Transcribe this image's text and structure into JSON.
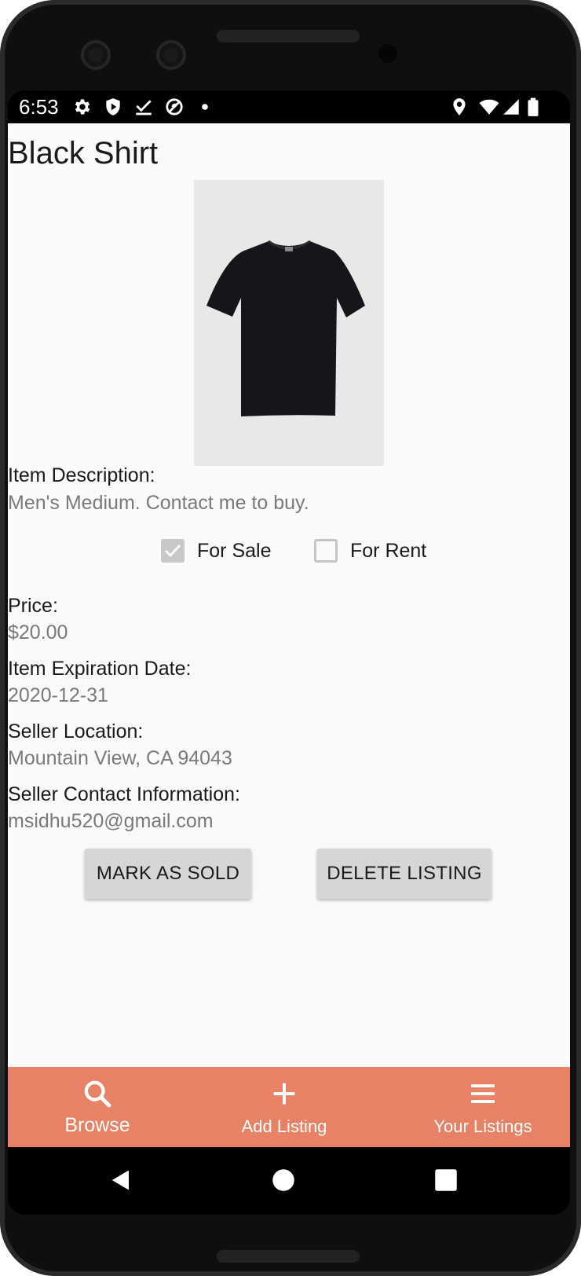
{
  "status_bar": {
    "time": "6:53",
    "left_icons": [
      "gear-icon",
      "shield-icon",
      "task-check-icon",
      "data-saver-icon",
      "dot-icon"
    ],
    "right_icons": [
      "location-icon",
      "wifi-icon",
      "signal-icon",
      "battery-icon"
    ]
  },
  "listing": {
    "title": "Black Shirt",
    "image_subject": "black t-shirt",
    "description_label": "Item Description:",
    "description_value": "Men's Medium. Contact me to buy.",
    "for_sale_label": "For Sale",
    "for_sale_checked": true,
    "for_rent_label": "For Rent",
    "for_rent_checked": false,
    "price_label": "Price:",
    "price_value": "$20.00",
    "expiration_label": "Item Expiration Date:",
    "expiration_value": "2020-12-31",
    "location_label": "Seller Location:",
    "location_value": "Mountain View, CA 94043",
    "contact_label": "Seller Contact Information:",
    "contact_value": "msidhu520@gmail.com"
  },
  "actions": {
    "mark_sold": "MARK AS SOLD",
    "delete": "DELETE LISTING"
  },
  "bottom_nav": {
    "accent_color": "#e78267",
    "items": [
      {
        "label": "Browse",
        "icon": "search-icon",
        "active": true
      },
      {
        "label": "Add Listing",
        "icon": "plus-icon",
        "active": false
      },
      {
        "label": "Your Listings",
        "icon": "menu-icon",
        "active": false
      }
    ]
  },
  "system_nav": [
    "back-icon",
    "home-icon",
    "recents-icon"
  ]
}
